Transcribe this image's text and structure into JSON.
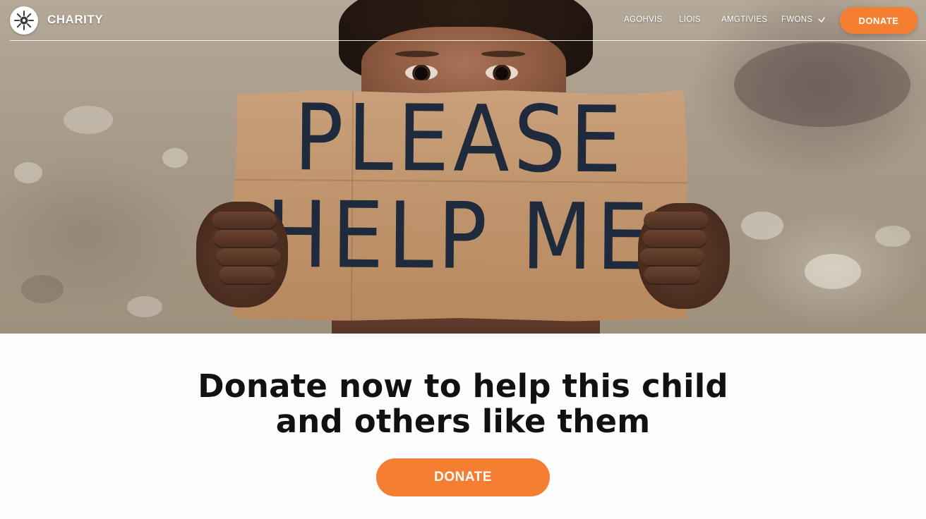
{
  "brand": {
    "name": "CHARITY",
    "logo_icon": "sun-emblem-icon"
  },
  "nav": {
    "links": [
      "AGOHVIS",
      "LIOIS",
      "AMGTIVIES",
      "FWONS"
    ],
    "dropdown_icon": "chevron-down-icon",
    "donate_label": "DONATE"
  },
  "hero": {
    "image": "child-holding-cardboard-sign-photo",
    "sign_lines": [
      "PLEASE",
      "HELP ME"
    ]
  },
  "main": {
    "headline_line1": "Donate now to help this child",
    "headline_line2": "and others like them",
    "cta_label": "DONATE"
  },
  "colors": {
    "accent": "#f47e32",
    "headline": "#111111",
    "nav_text": "#ffffff"
  }
}
